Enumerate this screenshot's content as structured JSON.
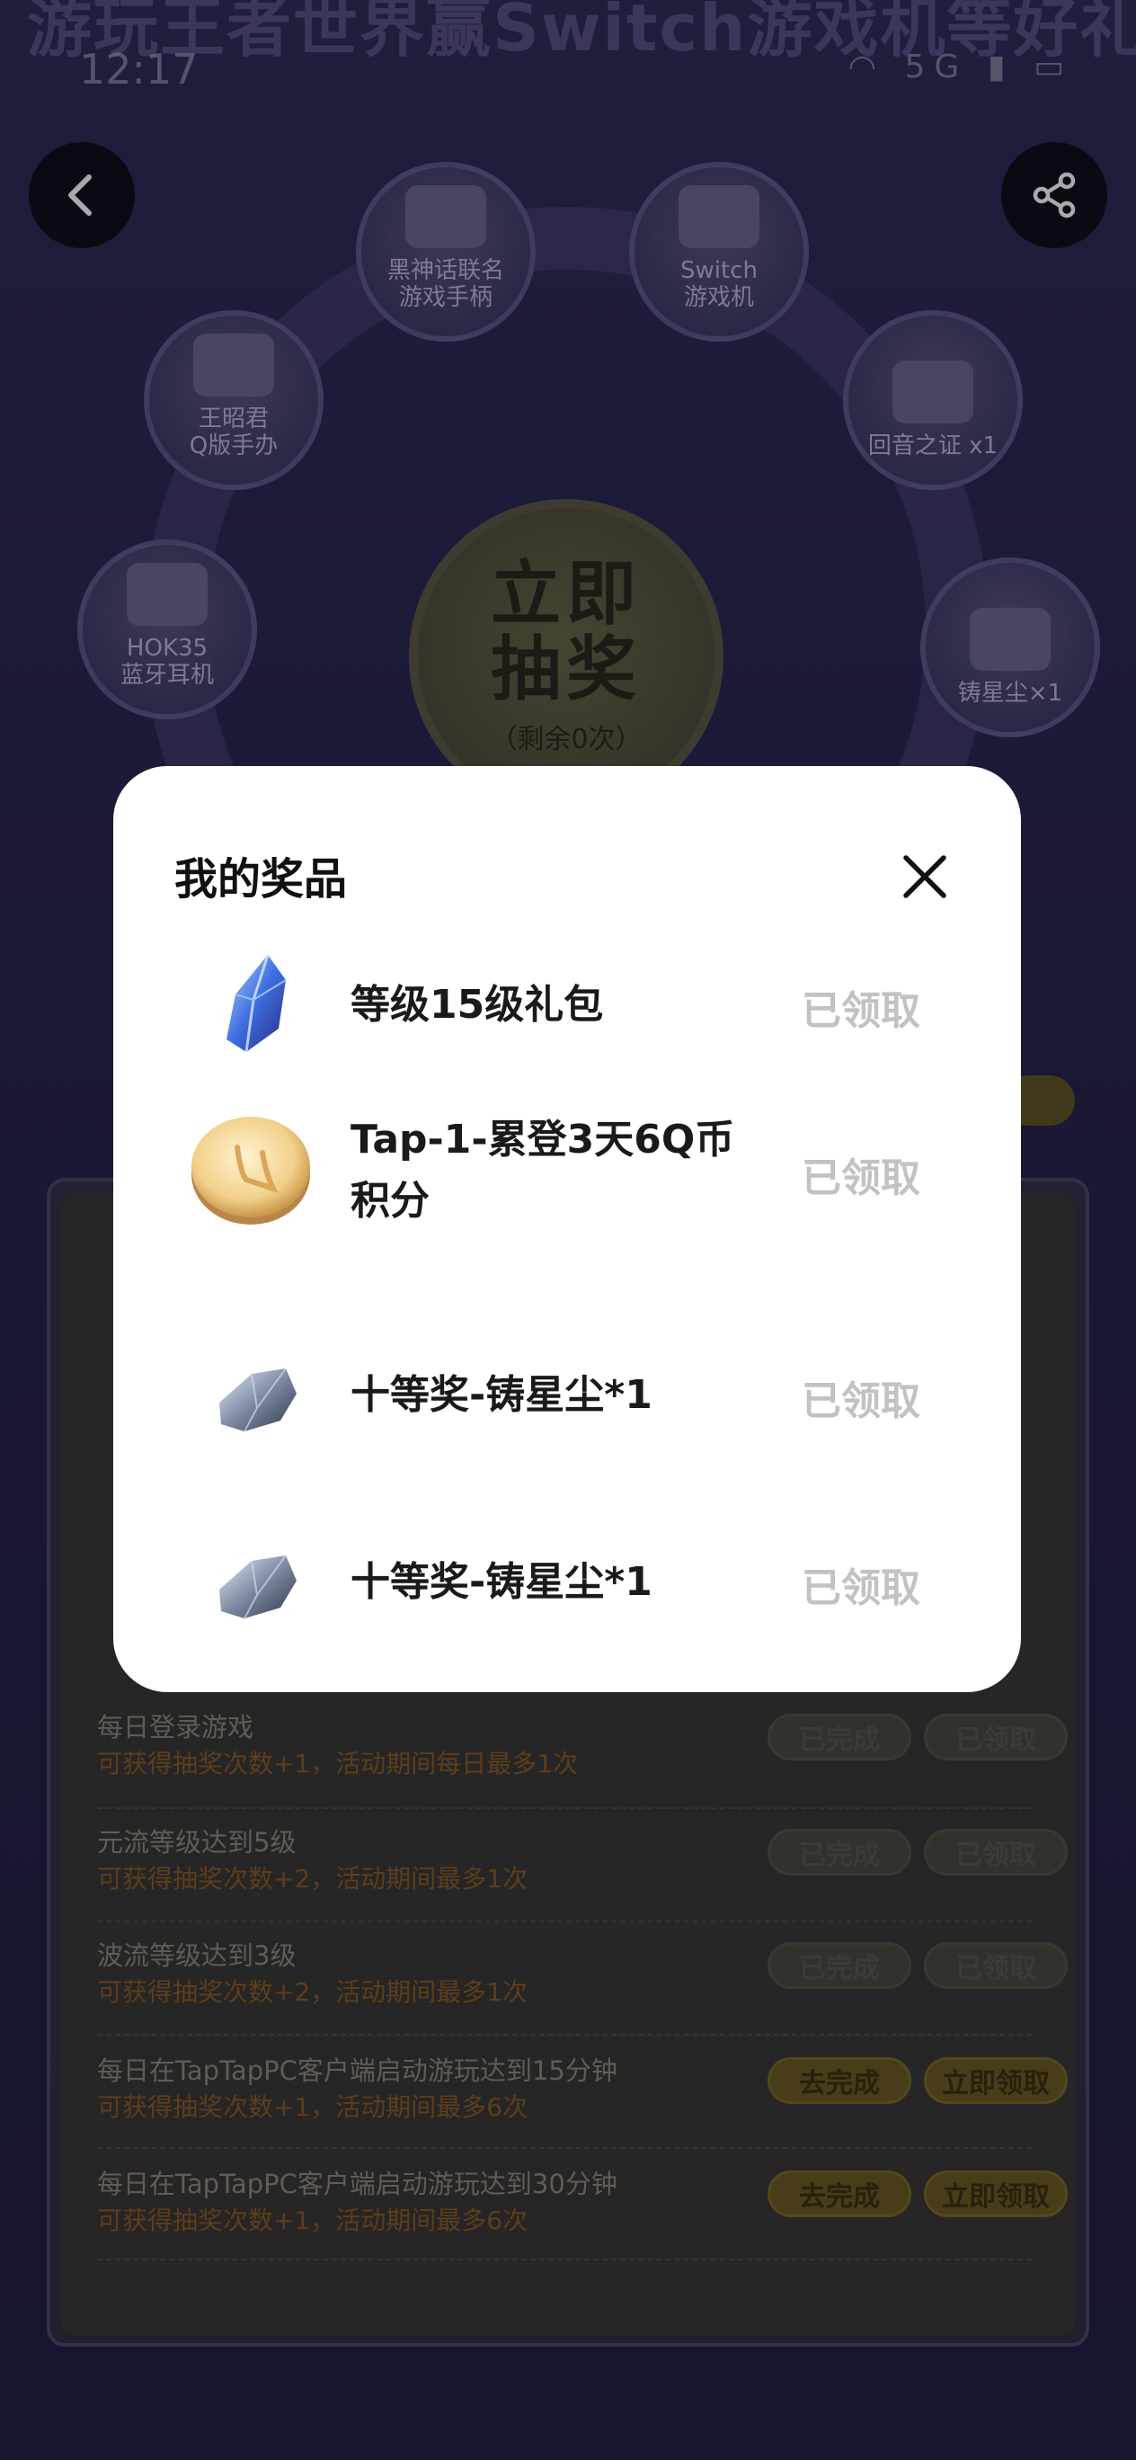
{
  "banner": {
    "text": "游玩王者世界赢Switch游戏机等好礼"
  },
  "status_bar": {
    "time": "12:17",
    "network": "5G"
  },
  "nav": {
    "back_icon": "chevron-left-icon",
    "share_icon": "share-icon"
  },
  "wheel": {
    "prizes": [
      {
        "label_line1": "黑神话联名",
        "label_line2": "游戏手柄"
      },
      {
        "label_line1": "Switch",
        "label_line2": "游戏机"
      },
      {
        "label_line1": "王昭君",
        "label_line2": "Q版手办"
      },
      {
        "label_line1": "回音之证 x1",
        "label_line2": ""
      },
      {
        "label_line1": "HOK35",
        "label_line2": "蓝牙耳机"
      },
      {
        "label_line1": "铸星尘×1",
        "label_line2": ""
      }
    ],
    "center": {
      "line1": "立即",
      "line2": "抽奖",
      "remaining": "（剩余0次）"
    }
  },
  "tasks": [
    {
      "title": "每日登录游戏",
      "desc": "可获得抽奖次数+1，活动期间每日最多1次",
      "btn1": "已完成",
      "btn2": "已领取",
      "style": "gray"
    },
    {
      "title": "元流等级达到5级",
      "desc": "可获得抽奖次数+2，活动期间最多1次",
      "btn1": "已完成",
      "btn2": "已领取",
      "style": "gray"
    },
    {
      "title": "波流等级达到3级",
      "desc": "可获得抽奖次数+2，活动期间最多1次",
      "btn1": "已完成",
      "btn2": "已领取",
      "style": "gray"
    },
    {
      "title": "每日在TapTapPC客户端启动游玩达到15分钟",
      "desc": "可获得抽奖次数+1，活动期间最多6次",
      "btn1": "去完成",
      "btn2": "立即领取",
      "style": "gold"
    },
    {
      "title": "每日在TapTapPC客户端启动游玩达到30分钟",
      "desc": "可获得抽奖次数+1，活动期间最多6次",
      "btn1": "去完成",
      "btn2": "立即领取",
      "style": "gold"
    }
  ],
  "modal": {
    "title": "我的奖品",
    "close_icon": "close-icon",
    "items": [
      {
        "name": "等级15级礼包",
        "status": "已领取",
        "icon": "blue-crystal-icon"
      },
      {
        "name": "Tap-1-累登3天6Q币积分",
        "status": "已领取",
        "icon": "gold-coin-icon"
      },
      {
        "name": "十等奖-铸星尘*1",
        "status": "已领取",
        "icon": "star-dust-stone-icon"
      },
      {
        "name": "十等奖-铸星尘*1",
        "status": "已领取",
        "icon": "star-dust-stone-icon"
      }
    ]
  }
}
